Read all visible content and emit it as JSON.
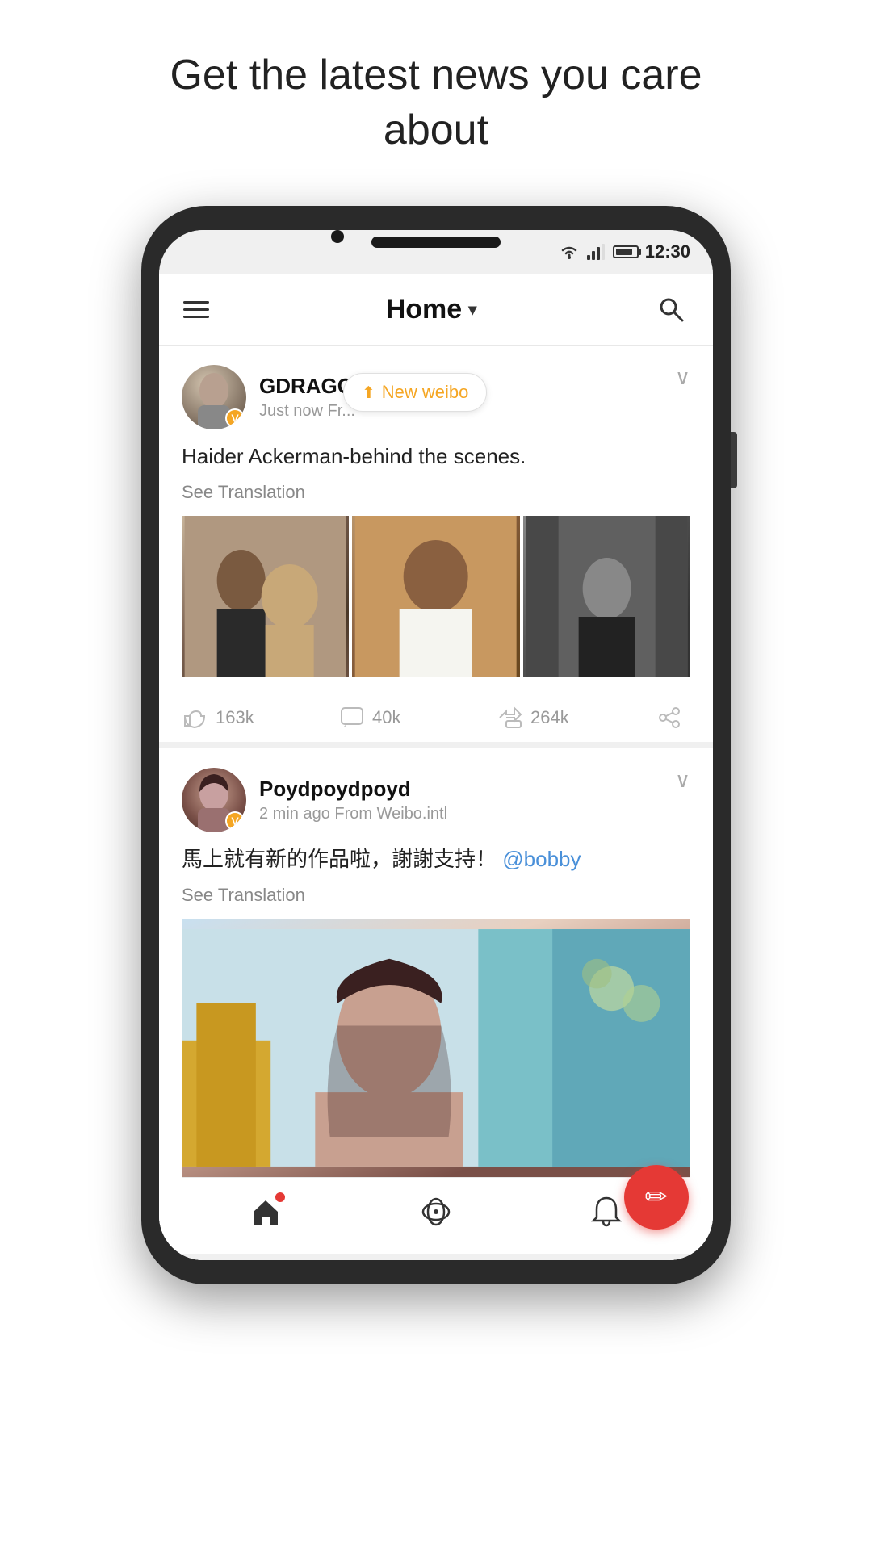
{
  "page": {
    "headline": "Get the latest news you care about"
  },
  "status_bar": {
    "time": "12:30"
  },
  "nav": {
    "title": "Home",
    "dropdown_label": "▾"
  },
  "new_weibo_badge": {
    "text": "New weibo"
  },
  "posts": [
    {
      "id": "post1",
      "username": "GDRAGON",
      "meta": "Just now  Fr...",
      "content": "Haider Ackerman-behind the scenes.",
      "see_translation": "See Translation",
      "stats": {
        "likes": "163k",
        "comments": "40k",
        "reposts": "264k"
      }
    },
    {
      "id": "post2",
      "username": "Poydpoydpoyd",
      "meta": "2 min ago   From Weibo.intl",
      "content": "馬上就有新的作品啦，謝謝支持！",
      "mention": "@bobby",
      "see_translation": "See Translation"
    }
  ],
  "bottom_nav": {
    "home_label": "home",
    "explore_label": "explore",
    "notifications_label": "notifications"
  },
  "fab": {
    "label": "compose"
  }
}
